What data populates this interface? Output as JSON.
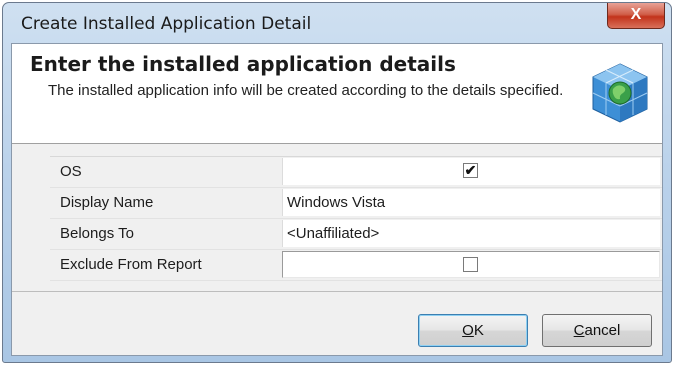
{
  "window": {
    "title": "Create Installed Application Detail",
    "close_label": "X"
  },
  "header": {
    "title": "Enter the installed application details",
    "description": "The installed application info will be created according to the details specified.",
    "icon": "globe-cube-icon"
  },
  "fields": [
    {
      "label": "OS",
      "type": "checkbox",
      "checked": true,
      "value": "✔"
    },
    {
      "label": "Display Name",
      "type": "text",
      "value": "Windows Vista"
    },
    {
      "label": "Belongs To",
      "type": "text",
      "value": "<Unaffiliated>"
    },
    {
      "label": "Exclude From Report",
      "type": "checkbox",
      "checked": false,
      "value": ""
    }
  ],
  "buttons": {
    "ok_first": "O",
    "ok_rest": "K",
    "cancel_first": "C",
    "cancel_rest": "ancel"
  },
  "colors": {
    "accent": "#3c7fb1",
    "close": "#c2331b"
  }
}
